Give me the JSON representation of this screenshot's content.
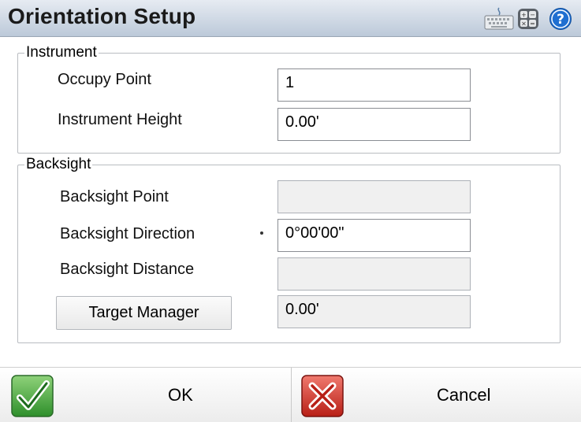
{
  "window": {
    "title": "Orientation Setup"
  },
  "title_icons": [
    "keyboard-icon",
    "calculator-icon",
    "help-icon"
  ],
  "instrument": {
    "legend": "Instrument",
    "occupy_point": {
      "label": "Occupy Point",
      "value": "1"
    },
    "instrument_height": {
      "label": "Instrument Height",
      "value": "0.00'"
    }
  },
  "backsight": {
    "legend": "Backsight",
    "point": {
      "label": "Backsight Point",
      "value": "",
      "selected": false
    },
    "direction": {
      "label": "Backsight Direction",
      "value": "0°00'00\"",
      "selected": true
    },
    "distance": {
      "label": "Backsight Distance",
      "value": ""
    },
    "target_manager": {
      "label": "Target Manager",
      "value": "0.00'"
    }
  },
  "actions": {
    "ok": "OK",
    "cancel": "Cancel"
  },
  "colors": {
    "accent_help": "#1f6fd1",
    "ok_green": "#3aa638",
    "cancel_red": "#d42a1f",
    "title_bg": "#c8d3e1"
  }
}
